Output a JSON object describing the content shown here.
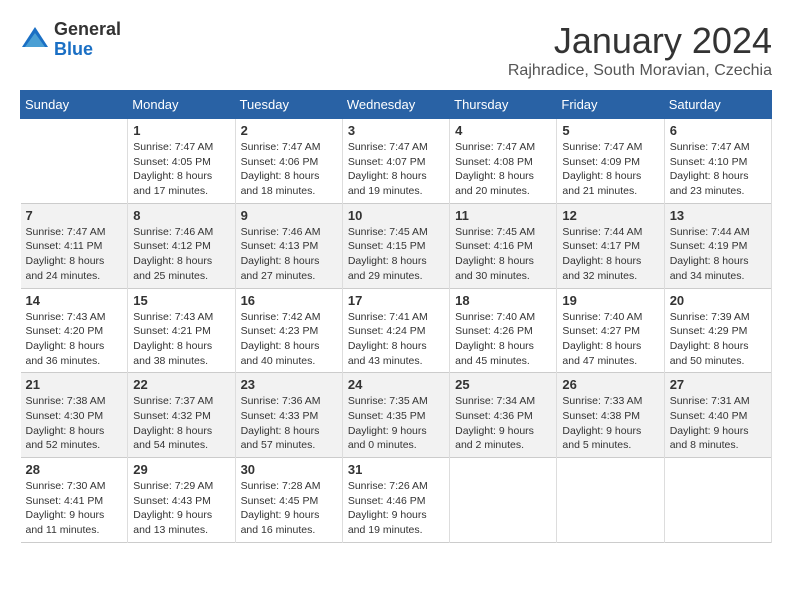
{
  "logo": {
    "general": "General",
    "blue": "Blue"
  },
  "header": {
    "month": "January 2024",
    "location": "Rajhradice, South Moravian, Czechia"
  },
  "weekdays": [
    "Sunday",
    "Monday",
    "Tuesday",
    "Wednesday",
    "Thursday",
    "Friday",
    "Saturday"
  ],
  "weeks": [
    [
      {
        "day": "",
        "sunrise": "",
        "sunset": "",
        "daylight": ""
      },
      {
        "day": "1",
        "sunrise": "Sunrise: 7:47 AM",
        "sunset": "Sunset: 4:05 PM",
        "daylight": "Daylight: 8 hours and 17 minutes."
      },
      {
        "day": "2",
        "sunrise": "Sunrise: 7:47 AM",
        "sunset": "Sunset: 4:06 PM",
        "daylight": "Daylight: 8 hours and 18 minutes."
      },
      {
        "day": "3",
        "sunrise": "Sunrise: 7:47 AM",
        "sunset": "Sunset: 4:07 PM",
        "daylight": "Daylight: 8 hours and 19 minutes."
      },
      {
        "day": "4",
        "sunrise": "Sunrise: 7:47 AM",
        "sunset": "Sunset: 4:08 PM",
        "daylight": "Daylight: 8 hours and 20 minutes."
      },
      {
        "day": "5",
        "sunrise": "Sunrise: 7:47 AM",
        "sunset": "Sunset: 4:09 PM",
        "daylight": "Daylight: 8 hours and 21 minutes."
      },
      {
        "day": "6",
        "sunrise": "Sunrise: 7:47 AM",
        "sunset": "Sunset: 4:10 PM",
        "daylight": "Daylight: 8 hours and 23 minutes."
      }
    ],
    [
      {
        "day": "7",
        "sunrise": "Sunrise: 7:47 AM",
        "sunset": "Sunset: 4:11 PM",
        "daylight": "Daylight: 8 hours and 24 minutes."
      },
      {
        "day": "8",
        "sunrise": "Sunrise: 7:46 AM",
        "sunset": "Sunset: 4:12 PM",
        "daylight": "Daylight: 8 hours and 25 minutes."
      },
      {
        "day": "9",
        "sunrise": "Sunrise: 7:46 AM",
        "sunset": "Sunset: 4:13 PM",
        "daylight": "Daylight: 8 hours and 27 minutes."
      },
      {
        "day": "10",
        "sunrise": "Sunrise: 7:45 AM",
        "sunset": "Sunset: 4:15 PM",
        "daylight": "Daylight: 8 hours and 29 minutes."
      },
      {
        "day": "11",
        "sunrise": "Sunrise: 7:45 AM",
        "sunset": "Sunset: 4:16 PM",
        "daylight": "Daylight: 8 hours and 30 minutes."
      },
      {
        "day": "12",
        "sunrise": "Sunrise: 7:44 AM",
        "sunset": "Sunset: 4:17 PM",
        "daylight": "Daylight: 8 hours and 32 minutes."
      },
      {
        "day": "13",
        "sunrise": "Sunrise: 7:44 AM",
        "sunset": "Sunset: 4:19 PM",
        "daylight": "Daylight: 8 hours and 34 minutes."
      }
    ],
    [
      {
        "day": "14",
        "sunrise": "Sunrise: 7:43 AM",
        "sunset": "Sunset: 4:20 PM",
        "daylight": "Daylight: 8 hours and 36 minutes."
      },
      {
        "day": "15",
        "sunrise": "Sunrise: 7:43 AM",
        "sunset": "Sunset: 4:21 PM",
        "daylight": "Daylight: 8 hours and 38 minutes."
      },
      {
        "day": "16",
        "sunrise": "Sunrise: 7:42 AM",
        "sunset": "Sunset: 4:23 PM",
        "daylight": "Daylight: 8 hours and 40 minutes."
      },
      {
        "day": "17",
        "sunrise": "Sunrise: 7:41 AM",
        "sunset": "Sunset: 4:24 PM",
        "daylight": "Daylight: 8 hours and 43 minutes."
      },
      {
        "day": "18",
        "sunrise": "Sunrise: 7:40 AM",
        "sunset": "Sunset: 4:26 PM",
        "daylight": "Daylight: 8 hours and 45 minutes."
      },
      {
        "day": "19",
        "sunrise": "Sunrise: 7:40 AM",
        "sunset": "Sunset: 4:27 PM",
        "daylight": "Daylight: 8 hours and 47 minutes."
      },
      {
        "day": "20",
        "sunrise": "Sunrise: 7:39 AM",
        "sunset": "Sunset: 4:29 PM",
        "daylight": "Daylight: 8 hours and 50 minutes."
      }
    ],
    [
      {
        "day": "21",
        "sunrise": "Sunrise: 7:38 AM",
        "sunset": "Sunset: 4:30 PM",
        "daylight": "Daylight: 8 hours and 52 minutes."
      },
      {
        "day": "22",
        "sunrise": "Sunrise: 7:37 AM",
        "sunset": "Sunset: 4:32 PM",
        "daylight": "Daylight: 8 hours and 54 minutes."
      },
      {
        "day": "23",
        "sunrise": "Sunrise: 7:36 AM",
        "sunset": "Sunset: 4:33 PM",
        "daylight": "Daylight: 8 hours and 57 minutes."
      },
      {
        "day": "24",
        "sunrise": "Sunrise: 7:35 AM",
        "sunset": "Sunset: 4:35 PM",
        "daylight": "Daylight: 9 hours and 0 minutes."
      },
      {
        "day": "25",
        "sunrise": "Sunrise: 7:34 AM",
        "sunset": "Sunset: 4:36 PM",
        "daylight": "Daylight: 9 hours and 2 minutes."
      },
      {
        "day": "26",
        "sunrise": "Sunrise: 7:33 AM",
        "sunset": "Sunset: 4:38 PM",
        "daylight": "Daylight: 9 hours and 5 minutes."
      },
      {
        "day": "27",
        "sunrise": "Sunrise: 7:31 AM",
        "sunset": "Sunset: 4:40 PM",
        "daylight": "Daylight: 9 hours and 8 minutes."
      }
    ],
    [
      {
        "day": "28",
        "sunrise": "Sunrise: 7:30 AM",
        "sunset": "Sunset: 4:41 PM",
        "daylight": "Daylight: 9 hours and 11 minutes."
      },
      {
        "day": "29",
        "sunrise": "Sunrise: 7:29 AM",
        "sunset": "Sunset: 4:43 PM",
        "daylight": "Daylight: 9 hours and 13 minutes."
      },
      {
        "day": "30",
        "sunrise": "Sunrise: 7:28 AM",
        "sunset": "Sunset: 4:45 PM",
        "daylight": "Daylight: 9 hours and 16 minutes."
      },
      {
        "day": "31",
        "sunrise": "Sunrise: 7:26 AM",
        "sunset": "Sunset: 4:46 PM",
        "daylight": "Daylight: 9 hours and 19 minutes."
      },
      {
        "day": "",
        "sunrise": "",
        "sunset": "",
        "daylight": ""
      },
      {
        "day": "",
        "sunrise": "",
        "sunset": "",
        "daylight": ""
      },
      {
        "day": "",
        "sunrise": "",
        "sunset": "",
        "daylight": ""
      }
    ]
  ]
}
